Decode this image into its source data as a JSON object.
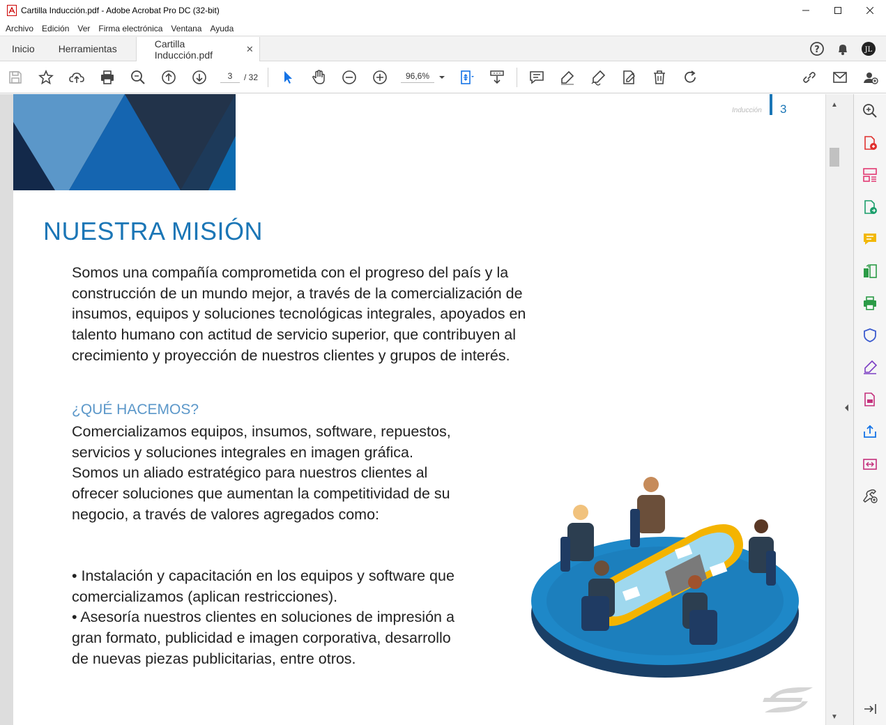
{
  "window": {
    "title": "Cartilla Inducción.pdf - Adobe Acrobat Pro DC (32-bit)"
  },
  "menu": [
    "Archivo",
    "Edición",
    "Ver",
    "Firma electrónica",
    "Ventana",
    "Ayuda"
  ],
  "tabs": {
    "home": "Inicio",
    "tools": "Herramientas",
    "document": "Cartilla Inducción.pdf"
  },
  "toolbar": {
    "current_page": "3",
    "page_separator": "/ 32",
    "zoom": "96,6%"
  },
  "document": {
    "header_label": "Inducción",
    "page_number": "3",
    "mission_title": "NUESTRA MISIÓN",
    "mission_text": "Somos una compañía comprometida con el progreso del país y la construcción de un mundo mejor, a través de la comercialización de insumos, equipos y soluciones tecnológicas integrales, apoyados en talento humano con actitud de servicio superior, que contribuyen al crecimiento y proyección de nuestros clientes y grupos de interés.",
    "what_title": "¿QUÉ HACEMOS?",
    "what_text": "Comercializamos equipos, insumos, software, repuestos, servicios y soluciones integrales en imagen gráfica. Somos un aliado estratégico para nuestros clientes al ofrecer soluciones que aumentan la competitividad de su negocio, a través de valores agregados como:",
    "bullet_1": "• Instalación y capacitación en los equipos y software que comercializamos (aplican restricciones).",
    "bullet_2": "• Asesoría nuestros clientes en soluciones de impresión a gran formato, publicidad e imagen corporativa, desarrollo de nuevas piezas publicitarias, entre otros."
  },
  "colors": {
    "accent": "#1b76b6",
    "subtitle": "#5b97c9"
  }
}
